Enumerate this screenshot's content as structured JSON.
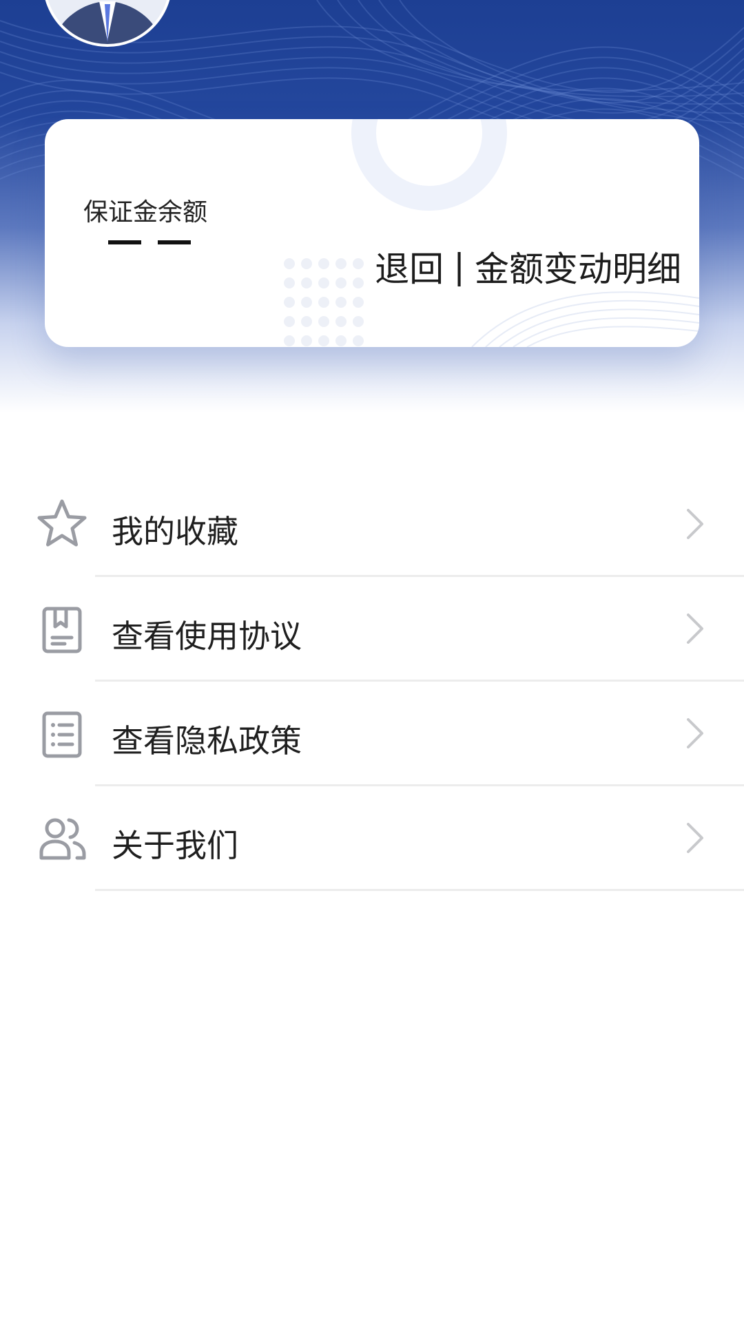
{
  "deposit_card": {
    "title": "保证金余额",
    "refund_label": "退回",
    "separator": "|",
    "details_label": "金额变动明细"
  },
  "menu": [
    {
      "label": "我的收藏",
      "icon": "star-icon"
    },
    {
      "label": "查看使用协议",
      "icon": "bookmark-document-icon"
    },
    {
      "label": "查看隐私政策",
      "icon": "list-document-icon"
    },
    {
      "label": "关于我们",
      "icon": "users-icon"
    }
  ],
  "colors": {
    "header_blue": "#1d3f93",
    "icon_gray": "#9a9ca3",
    "chevron_gray": "#c8c9cc",
    "text": "#1f1f1f"
  }
}
